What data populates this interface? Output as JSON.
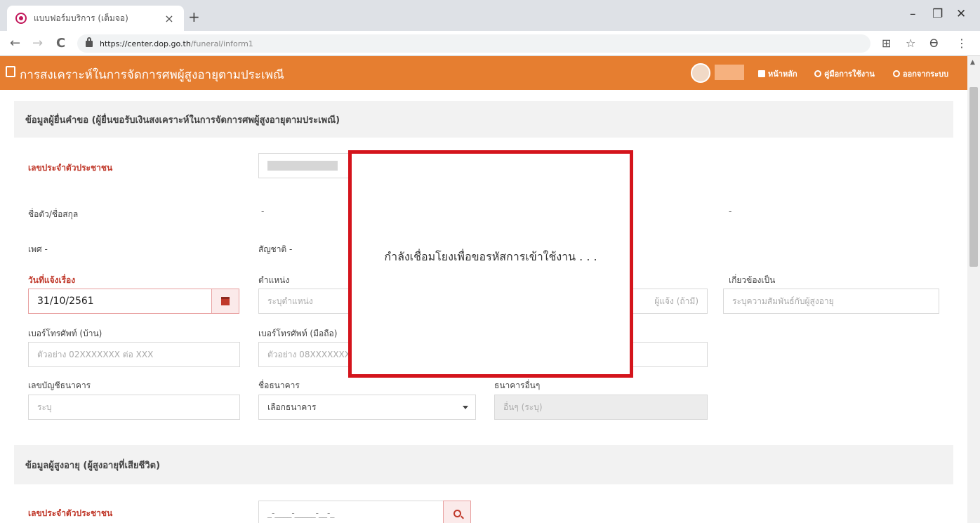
{
  "browser": {
    "tab_title": "แบบฟอร์มบริการ (เต็มจอ)",
    "tab_close": "×",
    "new_tab": "+",
    "url_host": "https://center.dop.go.th",
    "url_path": "/funeral/inform1",
    "win_min": "–",
    "win_max": "❐",
    "win_close": "✕",
    "back": "←",
    "forward": "→",
    "reload": "C",
    "translate": "⊞",
    "star": "☆",
    "account": "ϴ",
    "menu": "⋮"
  },
  "app": {
    "title": "การสงเคราะห์ในการจัดการศพผู้สูงอายุตามประเพณี",
    "nav": {
      "home": "หน้าหลัก",
      "manual": "คู่มือการใช้งาน",
      "logout": "ออกจากระบบ"
    }
  },
  "applicant": {
    "section_title": "ข้อมูลผู้ยื่นคำขอ (ผู้ยื่นขอรับเงินสงเคราะห์ในการจัดการศพผู้สูงอายุตามประเพณี)",
    "id_label": "เลขประจำตัวประชาชน",
    "name_label": "ชื่อตัว/ชื่อสกุล",
    "name_value": "-",
    "name_value_right": "-",
    "sex_label": "เพศ -",
    "nationality_label": "สัญชาติ -",
    "date_label": "วันที่แจ้งเรื่อง",
    "date_value": "31/10/2561",
    "position_label": "ตำแหน่ง",
    "position_placeholder": "ระบุตำแหน่ง",
    "position_suffix": "ผู้แจ้ง (ถ้ามี)",
    "relation_label": "เกี่ยวข้องเป็น",
    "relation_placeholder": "ระบุความสัมพันธ์กับผู้สูงอายุ",
    "home_phone_label": "เบอร์โทรศัพท์ (บ้าน)",
    "home_phone_placeholder": "ตัวอย่าง 02XXXXXXX ต่อ XXX",
    "mobile_label": "เบอร์โทรศัพท์ (มือถือ)",
    "mobile_placeholder": "ตัวอย่าง 08XXXXXXXX",
    "bank_account_label": "เลขบัญชีธนาคาร",
    "bank_account_placeholder": "ระบุ",
    "bank_name_label": "ชื่อธนาคาร",
    "bank_name_value": "เลือกธนาคาร",
    "other_bank_label": "ธนาคารอื่นๆ",
    "other_bank_placeholder": "อื่นๆ (ระบุ)"
  },
  "elder": {
    "section_title": "ข้อมูลผู้สูงอายุ (ผู้สูงอายุที่เสียชีวิต)",
    "id_label": "เลขประจำตัวประชาชน",
    "id_placeholder": "_-____-_____-__-_"
  },
  "dialog": {
    "message": "กำลังเชื่อมโยงเพื่อขอรหัสการเข้าใช้งาน . . ."
  },
  "colors": {
    "header": "#e67e30",
    "required_label": "#c0392b",
    "dialog_border": "#d4141c"
  }
}
